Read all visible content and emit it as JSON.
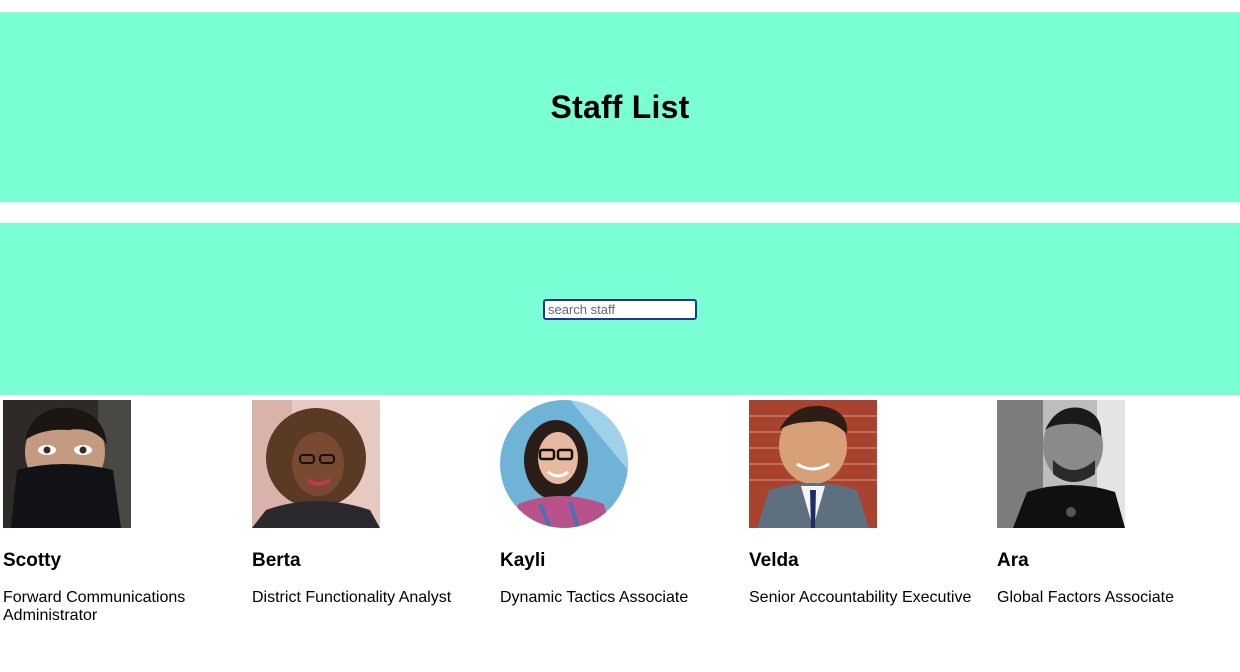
{
  "header": {
    "title": "Staff List"
  },
  "search": {
    "placeholder": "search staff",
    "value": ""
  },
  "staff": [
    {
      "name": "Scotty",
      "title": "Forward Communications Administrator",
      "photo": "avatar-photo"
    },
    {
      "name": "Berta",
      "title": "District Functionality Analyst",
      "photo": "avatar-photo"
    },
    {
      "name": "Kayli",
      "title": "Dynamic Tactics Associate",
      "photo": "avatar-photo"
    },
    {
      "name": "Velda",
      "title": "Senior Accountability Executive",
      "photo": "avatar-photo"
    },
    {
      "name": "Ara",
      "title": "Global Factors Associate",
      "photo": "avatar-photo"
    }
  ],
  "colors": {
    "band": "#79ffd3",
    "input_border": "#1a3a8f"
  }
}
